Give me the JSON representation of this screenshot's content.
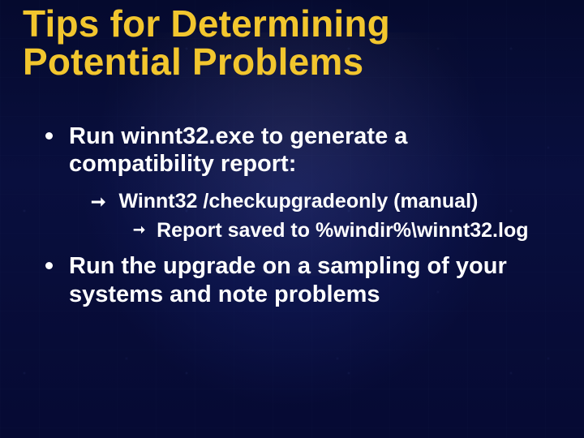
{
  "title": "Tips for Determining Potential Problems",
  "bullets": {
    "b1": {
      "text": "Run winnt32.exe to generate a compatibility report:",
      "sub1": {
        "text": "Winnt32 /checkupgradeonly (manual)",
        "sub1": {
          "text": "Report saved to %windir%\\winnt32.log"
        }
      }
    },
    "b2": {
      "text": "Run the upgrade on a sampling of your systems and note problems"
    }
  }
}
